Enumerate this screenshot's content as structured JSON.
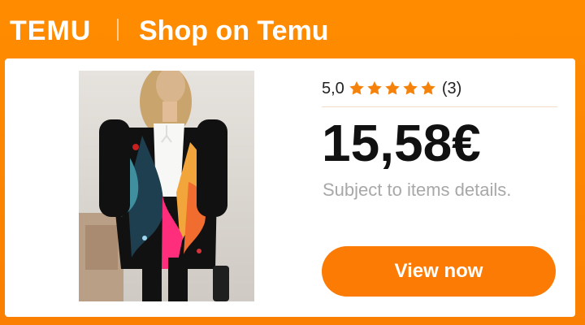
{
  "header": {
    "logo_text": "TEMU",
    "title": "Shop on Temu"
  },
  "product": {
    "image_icon": "product-photo-floral-blazer",
    "rating_value": "5,0",
    "star_count": 5,
    "review_count": "(3)",
    "price": "15,58€",
    "note": "Subject to items details.",
    "cta_label": "View now"
  },
  "colors": {
    "brand_orange": "#fb8a00",
    "button_orange": "#fb7b05",
    "star_orange": "#f5820b",
    "muted_text": "#a8a8a8"
  }
}
